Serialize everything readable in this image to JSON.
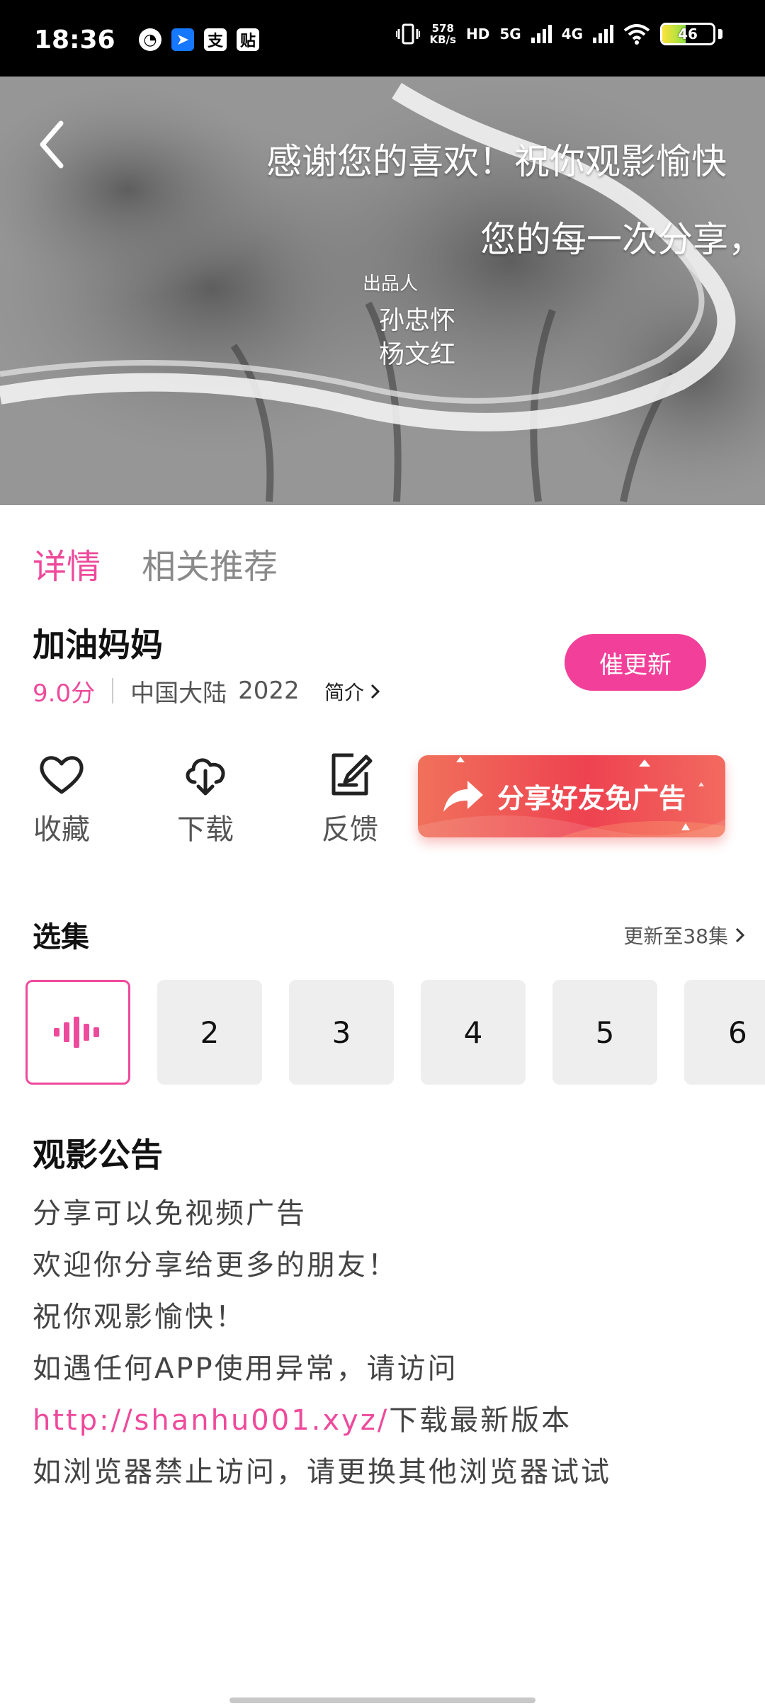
{
  "status_bar": {
    "time": "18:36",
    "left_icons": [
      "speedometer-icon",
      "pin-icon",
      "zhi-icon",
      "tie-icon"
    ],
    "net_speed_value": "578",
    "net_speed_unit": "KB/s",
    "hd_label": "HD",
    "sim1_label": "5G",
    "sim2_label": "4G",
    "battery_level": "46",
    "battery_fraction": 0.46
  },
  "video": {
    "subtitle_line1": "感谢您的喜欢！祝你观影愉快",
    "subtitle_line2": "您的每一次分享，",
    "credit_title": "出品人",
    "credit_names": [
      "孙忠怀",
      "杨文红"
    ]
  },
  "tabs": [
    {
      "label": "详情",
      "active": true
    },
    {
      "label": "相关推荐",
      "active": false
    }
  ],
  "show": {
    "title": "加油妈妈",
    "score": "9.0分",
    "region": "中国大陆",
    "year": "2022",
    "intro_label": "简介",
    "urge_update_label": "催更新"
  },
  "actions": [
    {
      "label": "收藏",
      "icon": "heart-icon"
    },
    {
      "label": "下载",
      "icon": "cloud-download-icon"
    },
    {
      "label": "反馈",
      "icon": "edit-icon"
    }
  ],
  "share": {
    "label": "分享好友免广告"
  },
  "episodes": {
    "section_title": "选集",
    "update_label": "更新至38集",
    "items": [
      "1",
      "2",
      "3",
      "4",
      "5",
      "6"
    ],
    "current": "1"
  },
  "notice": {
    "title": "观影公告",
    "lines": [
      "分享可以免视频广告",
      "欢迎你分享给更多的朋友！",
      "祝你观影愉快！",
      "如遇任何APP使用异常，请访问"
    ],
    "link": "http://shanhu001.xyz/",
    "link_suffix": "下载最新版本",
    "last_line": "如浏览器禁止访问，请更换其他浏览器试试"
  },
  "colors": {
    "accent": "#ee4a9b",
    "share_gradient_start": "#f0715b",
    "share_gradient_end": "#ee4250"
  }
}
